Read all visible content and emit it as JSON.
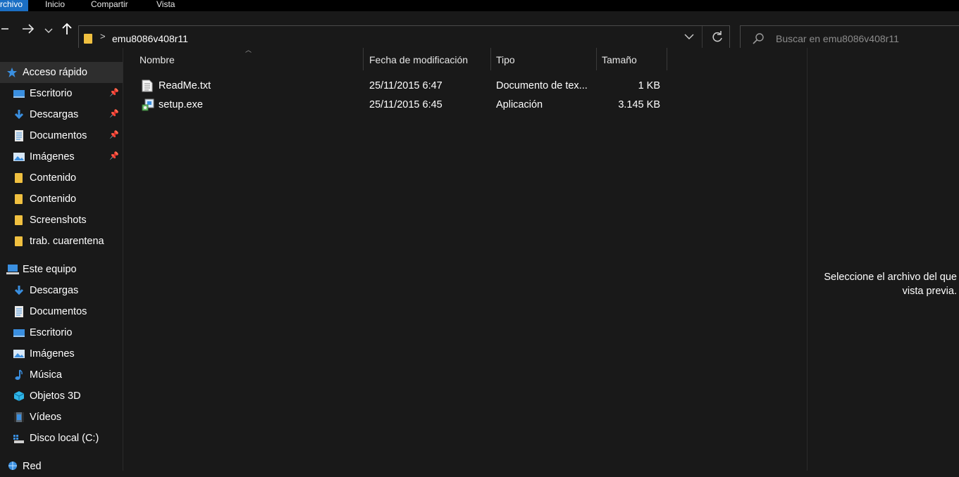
{
  "ribbon": {
    "tabs": [
      "rchivo",
      "Inicio",
      "Compartir",
      "Vista"
    ]
  },
  "address": {
    "path": "emu8086v408r11"
  },
  "search": {
    "placeholder": "Buscar en emu8086v408r11"
  },
  "sidebar": {
    "quick_access": {
      "label": "Acceso rápido",
      "items": [
        {
          "label": "Escritorio",
          "icon": "desktop-icon",
          "pinned": true
        },
        {
          "label": "Descargas",
          "icon": "download-icon",
          "pinned": true
        },
        {
          "label": "Documentos",
          "icon": "document-icon",
          "pinned": true
        },
        {
          "label": "Imágenes",
          "icon": "pictures-icon",
          "pinned": true
        },
        {
          "label": "Contenido",
          "icon": "folder-icon",
          "pinned": false
        },
        {
          "label": "Contenido",
          "icon": "folder-icon",
          "pinned": false
        },
        {
          "label": "Screenshots",
          "icon": "folder-icon",
          "pinned": false
        },
        {
          "label": "trab. cuarentena",
          "icon": "folder-icon",
          "pinned": false
        }
      ]
    },
    "this_pc": {
      "label": "Este equipo",
      "items": [
        {
          "label": "Descargas",
          "icon": "download-icon"
        },
        {
          "label": "Documentos",
          "icon": "document-icon"
        },
        {
          "label": "Escritorio",
          "icon": "desktop-icon"
        },
        {
          "label": "Imágenes",
          "icon": "pictures-icon"
        },
        {
          "label": "Música",
          "icon": "music-icon"
        },
        {
          "label": "Objetos 3D",
          "icon": "3d-objects-icon"
        },
        {
          "label": "Vídeos",
          "icon": "videos-icon"
        },
        {
          "label": "Disco local (C:)",
          "icon": "drive-icon"
        }
      ]
    },
    "network": {
      "label": "Red"
    }
  },
  "file_list": {
    "columns": [
      "Nombre",
      "Fecha de modificación",
      "Tipo",
      "Tamaño"
    ],
    "rows": [
      {
        "name": "ReadMe.txt",
        "date": "25/11/2015 6:47",
        "type": "Documento de tex...",
        "size": "1 KB",
        "icon": "text-file-icon"
      },
      {
        "name": "setup.exe",
        "date": "25/11/2015 6:45",
        "type": "Aplicación",
        "size": "3.145 KB",
        "icon": "installer-icon"
      }
    ]
  },
  "preview": {
    "line1": "Seleccione el archivo del que",
    "line2": "vista previa."
  },
  "colors": {
    "background": "#191919",
    "accent": "#1b6fc4",
    "folder": "#f0c040",
    "blue_icon": "#3a8fe0"
  }
}
